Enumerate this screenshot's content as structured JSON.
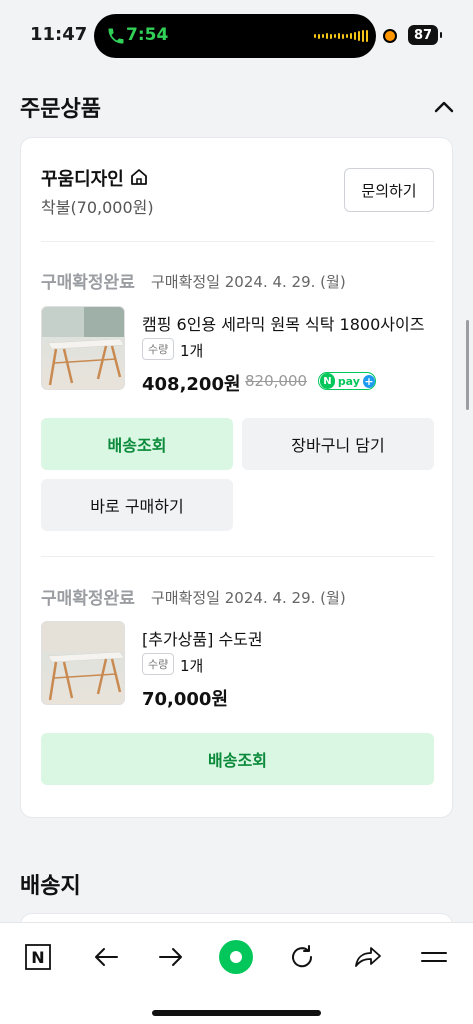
{
  "status_bar": {
    "time": "11:47",
    "call_time": "7:54",
    "battery": "87"
  },
  "section": {
    "title": "주문상품"
  },
  "seller": {
    "name": "꾸움디자인",
    "shipping_fee": "착불(70,000원)",
    "inquiry_label": "문의하기"
  },
  "orders": [
    {
      "status": "구매확정완료",
      "date": "구매확정일 2024. 4. 29. (월)",
      "product_name": "캠핑 6인용 세라믹 원목 식탁 1800사이즈",
      "qty_label": "수량",
      "qty": "1개",
      "price": "408,200원",
      "original_price": "820,000",
      "npay": {
        "n": "N",
        "text": "pay"
      },
      "buttons": {
        "tracking": "배송조회",
        "cart": "장바구니 담기",
        "buy_now": "바로 구매하기"
      }
    },
    {
      "status": "구매확정완료",
      "date": "구매확정일 2024. 4. 29. (월)",
      "product_name": "[추가상품] 수도권",
      "qty_label": "수량",
      "qty": "1개",
      "price": "70,000원",
      "buttons": {
        "tracking": "배송조회"
      }
    }
  ],
  "shipping_section": {
    "title": "배송지"
  },
  "toolbar": {
    "items": [
      "naver-home-icon",
      "back-icon",
      "forward-icon",
      "green-dot-icon",
      "refresh-icon",
      "share-icon",
      "menu-icon"
    ],
    "n_letter": "N"
  },
  "colors": {
    "accent_green": "#03c75a",
    "tracking_bg": "#d9f7e2",
    "tracking_text": "#0a8a3a"
  }
}
